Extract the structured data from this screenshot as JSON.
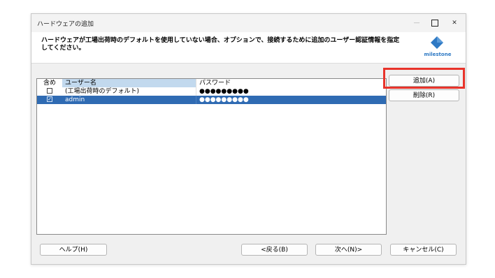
{
  "window": {
    "title": "ハードウェアの追加",
    "minimize_glyph": "—",
    "close_glyph": "✕"
  },
  "header": {
    "instruction": "ハードウェアが工場出荷時のデフォルトを使用していない場合、オプションで、接続するために追加のユーザー認証情報を指定してください。",
    "logo_text": "milestone",
    "logo_color": "#2e79c4"
  },
  "table": {
    "columns": [
      "含め",
      "ユーザー名",
      "パスワード"
    ],
    "rows": [
      {
        "include": false,
        "username": "(工場出荷時のデフォルト)",
        "password": "●●●●●●●●●",
        "selected": false
      },
      {
        "include": true,
        "username": "admin",
        "password": "●●●●●●●●●",
        "selected": true
      }
    ],
    "check_glyph": "✓"
  },
  "side_buttons": {
    "add": "追加(A)",
    "delete": "削除(R)"
  },
  "footer": {
    "help": "ヘルプ(H)",
    "back": "<戻る(B)",
    "next": "次へ(N)>",
    "cancel": "キャンセル(C)"
  },
  "colors": {
    "selection": "#2f6bb3",
    "column_header_active": "#c2d9ee",
    "highlight_box": "#e8332a"
  }
}
